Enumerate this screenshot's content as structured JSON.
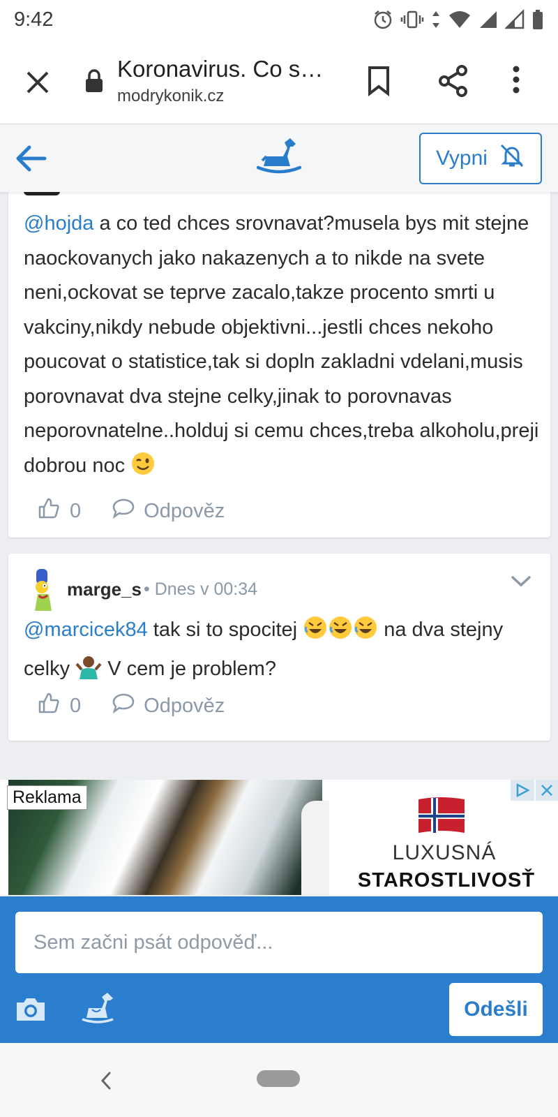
{
  "status_bar": {
    "time": "9:42",
    "icons": [
      "alarm-icon",
      "vibrate-icon",
      "data-arrows-icon",
      "wifi-icon",
      "signal-icon",
      "signal-icon",
      "battery-icon"
    ]
  },
  "browser": {
    "page_title": "Koronavirus. Co s…",
    "domain": "modrykonik.cz",
    "icons": [
      "close-icon",
      "lock-icon",
      "bookmark-icon",
      "share-icon",
      "more-vert-icon"
    ]
  },
  "site_header": {
    "mute_button_label": "Vypni",
    "icons": [
      "back-arrow-icon",
      "rocking-horse-logo",
      "bell-off-icon"
    ]
  },
  "comments": [
    {
      "mention": "@hojda",
      "text": " a co ted chces srovnavat?musela bys mit stejne naockovanych jako nakazenych a to nikde na svete neni,ockovat se teprve zacalo,takze procento smrti u vakciny,nikdy nebude objektivni...jestli chces nekoho poucovat o statistice,tak si dopln zakladni vdelani,musis porovnavat dva stejne celky,jinak to porovnavas neporovnatelne..holduj si cemu chces,treba alkoholu,preji dobrou noc",
      "emoji": "winking-face-emoji",
      "likes": "0",
      "reply_label": "Odpověz"
    },
    {
      "author": "marge_s",
      "separator": "•",
      "timestamp": "Dnes v 00:34",
      "mention": "@marcicek84",
      "text_part1": " tak si to spocitej ",
      "emojis_part1": [
        "rolling-laughing-emoji",
        "rolling-laughing-emoji",
        "rolling-laughing-emoji"
      ],
      "text_part2": " na dva stejny celky ",
      "emoji_part2": "shrug-emoji",
      "text_part3": " V cem je problem?",
      "likes": "0",
      "reply_label": "Odpověz"
    }
  ],
  "ad": {
    "badge": "Reklama",
    "line1": "LUXUSNÁ",
    "line2": "STAROSTLIVOSŤ",
    "icons": [
      "adchoices-icon",
      "close-ad-icon",
      "norway-flag"
    ]
  },
  "composer": {
    "placeholder": "Sem začni psát odpověď...",
    "send_label": "Odešli",
    "icons": [
      "camera-icon",
      "horse-sticker-icon"
    ]
  },
  "nav": {
    "icons": [
      "nav-back-icon",
      "home-pill"
    ]
  },
  "colors": {
    "accent": "#2a7dcb",
    "composer_bg": "#2b7dcd",
    "page_bg": "#eceef1",
    "muted": "#8b98a8"
  }
}
